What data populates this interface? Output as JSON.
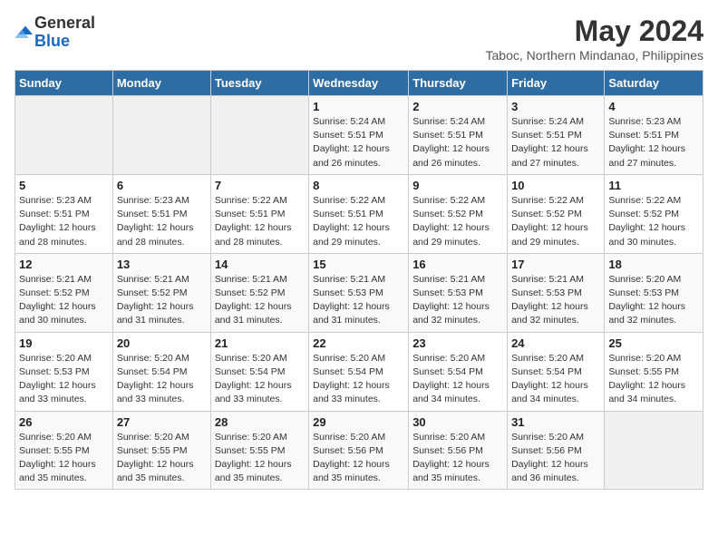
{
  "logo": {
    "general": "General",
    "blue": "Blue"
  },
  "title": "May 2024",
  "location": "Taboc, Northern Mindanao, Philippines",
  "weekdays": [
    "Sunday",
    "Monday",
    "Tuesday",
    "Wednesday",
    "Thursday",
    "Friday",
    "Saturday"
  ],
  "weeks": [
    [
      {
        "day": "",
        "info": ""
      },
      {
        "day": "",
        "info": ""
      },
      {
        "day": "",
        "info": ""
      },
      {
        "day": "1",
        "info": "Sunrise: 5:24 AM\nSunset: 5:51 PM\nDaylight: 12 hours\nand 26 minutes."
      },
      {
        "day": "2",
        "info": "Sunrise: 5:24 AM\nSunset: 5:51 PM\nDaylight: 12 hours\nand 26 minutes."
      },
      {
        "day": "3",
        "info": "Sunrise: 5:24 AM\nSunset: 5:51 PM\nDaylight: 12 hours\nand 27 minutes."
      },
      {
        "day": "4",
        "info": "Sunrise: 5:23 AM\nSunset: 5:51 PM\nDaylight: 12 hours\nand 27 minutes."
      }
    ],
    [
      {
        "day": "5",
        "info": "Sunrise: 5:23 AM\nSunset: 5:51 PM\nDaylight: 12 hours\nand 28 minutes."
      },
      {
        "day": "6",
        "info": "Sunrise: 5:23 AM\nSunset: 5:51 PM\nDaylight: 12 hours\nand 28 minutes."
      },
      {
        "day": "7",
        "info": "Sunrise: 5:22 AM\nSunset: 5:51 PM\nDaylight: 12 hours\nand 28 minutes."
      },
      {
        "day": "8",
        "info": "Sunrise: 5:22 AM\nSunset: 5:51 PM\nDaylight: 12 hours\nand 29 minutes."
      },
      {
        "day": "9",
        "info": "Sunrise: 5:22 AM\nSunset: 5:52 PM\nDaylight: 12 hours\nand 29 minutes."
      },
      {
        "day": "10",
        "info": "Sunrise: 5:22 AM\nSunset: 5:52 PM\nDaylight: 12 hours\nand 29 minutes."
      },
      {
        "day": "11",
        "info": "Sunrise: 5:22 AM\nSunset: 5:52 PM\nDaylight: 12 hours\nand 30 minutes."
      }
    ],
    [
      {
        "day": "12",
        "info": "Sunrise: 5:21 AM\nSunset: 5:52 PM\nDaylight: 12 hours\nand 30 minutes."
      },
      {
        "day": "13",
        "info": "Sunrise: 5:21 AM\nSunset: 5:52 PM\nDaylight: 12 hours\nand 31 minutes."
      },
      {
        "day": "14",
        "info": "Sunrise: 5:21 AM\nSunset: 5:52 PM\nDaylight: 12 hours\nand 31 minutes."
      },
      {
        "day": "15",
        "info": "Sunrise: 5:21 AM\nSunset: 5:53 PM\nDaylight: 12 hours\nand 31 minutes."
      },
      {
        "day": "16",
        "info": "Sunrise: 5:21 AM\nSunset: 5:53 PM\nDaylight: 12 hours\nand 32 minutes."
      },
      {
        "day": "17",
        "info": "Sunrise: 5:21 AM\nSunset: 5:53 PM\nDaylight: 12 hours\nand 32 minutes."
      },
      {
        "day": "18",
        "info": "Sunrise: 5:20 AM\nSunset: 5:53 PM\nDaylight: 12 hours\nand 32 minutes."
      }
    ],
    [
      {
        "day": "19",
        "info": "Sunrise: 5:20 AM\nSunset: 5:53 PM\nDaylight: 12 hours\nand 33 minutes."
      },
      {
        "day": "20",
        "info": "Sunrise: 5:20 AM\nSunset: 5:54 PM\nDaylight: 12 hours\nand 33 minutes."
      },
      {
        "day": "21",
        "info": "Sunrise: 5:20 AM\nSunset: 5:54 PM\nDaylight: 12 hours\nand 33 minutes."
      },
      {
        "day": "22",
        "info": "Sunrise: 5:20 AM\nSunset: 5:54 PM\nDaylight: 12 hours\nand 33 minutes."
      },
      {
        "day": "23",
        "info": "Sunrise: 5:20 AM\nSunset: 5:54 PM\nDaylight: 12 hours\nand 34 minutes."
      },
      {
        "day": "24",
        "info": "Sunrise: 5:20 AM\nSunset: 5:54 PM\nDaylight: 12 hours\nand 34 minutes."
      },
      {
        "day": "25",
        "info": "Sunrise: 5:20 AM\nSunset: 5:55 PM\nDaylight: 12 hours\nand 34 minutes."
      }
    ],
    [
      {
        "day": "26",
        "info": "Sunrise: 5:20 AM\nSunset: 5:55 PM\nDaylight: 12 hours\nand 35 minutes."
      },
      {
        "day": "27",
        "info": "Sunrise: 5:20 AM\nSunset: 5:55 PM\nDaylight: 12 hours\nand 35 minutes."
      },
      {
        "day": "28",
        "info": "Sunrise: 5:20 AM\nSunset: 5:55 PM\nDaylight: 12 hours\nand 35 minutes."
      },
      {
        "day": "29",
        "info": "Sunrise: 5:20 AM\nSunset: 5:56 PM\nDaylight: 12 hours\nand 35 minutes."
      },
      {
        "day": "30",
        "info": "Sunrise: 5:20 AM\nSunset: 5:56 PM\nDaylight: 12 hours\nand 35 minutes."
      },
      {
        "day": "31",
        "info": "Sunrise: 5:20 AM\nSunset: 5:56 PM\nDaylight: 12 hours\nand 36 minutes."
      },
      {
        "day": "",
        "info": ""
      }
    ]
  ]
}
